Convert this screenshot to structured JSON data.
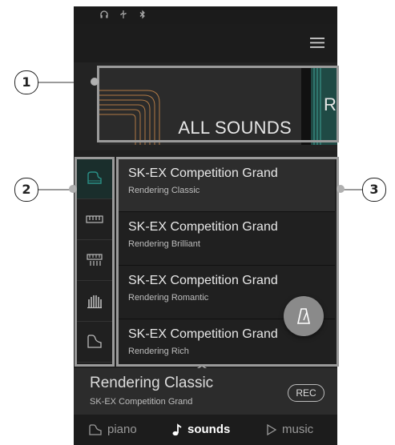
{
  "callouts": {
    "one": "1",
    "two": "2",
    "three": "3"
  },
  "status_icons": [
    "headphones-icon",
    "usb-icon",
    "bluetooth-icon"
  ],
  "carousel": {
    "current_card": "ALL SOUNDS",
    "next_card_partial": "R"
  },
  "sidebar": {
    "items": [
      {
        "icon": "grand-piano-icon",
        "active": true
      },
      {
        "icon": "keyboard-icon",
        "active": false
      },
      {
        "icon": "organ-icon",
        "active": false
      },
      {
        "icon": "pipe-organ-icon",
        "active": false
      },
      {
        "icon": "piano-outline-icon",
        "active": false
      }
    ]
  },
  "sound_list": [
    {
      "title": "SK-EX Competition Grand",
      "subtitle": "Rendering Classic",
      "active": true
    },
    {
      "title": "SK-EX Competition Grand",
      "subtitle": "Rendering Brilliant",
      "active": false
    },
    {
      "title": "SK-EX Competition Grand",
      "subtitle": "Rendering Romantic",
      "active": false
    },
    {
      "title": "SK-EX Competition Grand",
      "subtitle": "Rendering Rich",
      "active": false
    }
  ],
  "now_playing": {
    "title": "Rendering Classic",
    "subtitle": "SK-EX Competition Grand",
    "rec_label": "REC"
  },
  "bottom_nav": [
    {
      "label": "piano",
      "icon": "piano-icon",
      "active": false
    },
    {
      "label": "sounds",
      "icon": "music-note-icon",
      "active": true
    },
    {
      "label": "music",
      "icon": "play-icon",
      "active": false
    }
  ],
  "colors": {
    "background": "#202020",
    "accent": "#2a8f86",
    "highlight_border": "#9a9a9a"
  }
}
